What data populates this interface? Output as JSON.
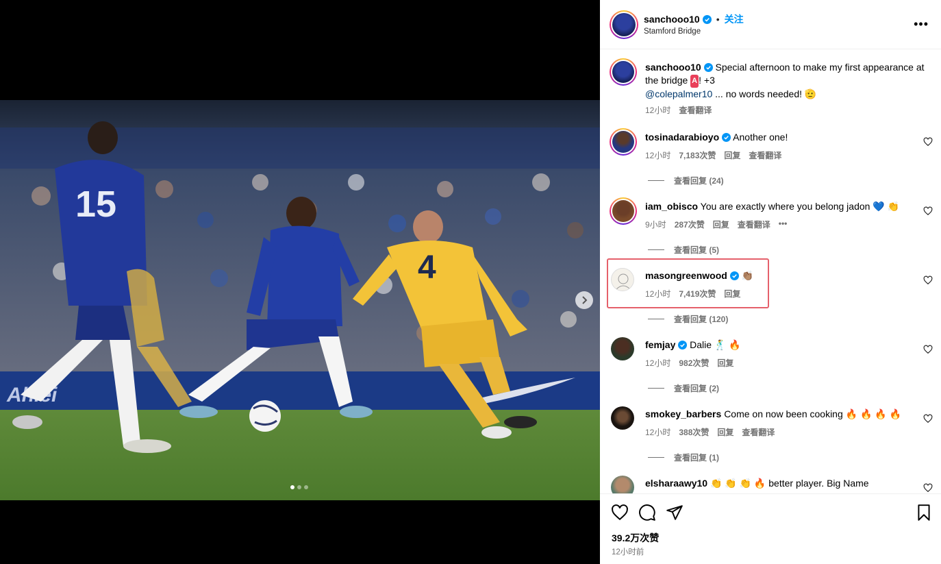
{
  "header": {
    "username": "sanchooo10",
    "follow_label": "关注",
    "location": "Stamford Bridge",
    "more_label": "•••"
  },
  "caption": {
    "username": "sanchooo10",
    "text_1": "Special afternoon to make my first appearance at the bridge",
    "badge": "A",
    "text_2": "! +3",
    "mention": "@colepalmer10",
    "text_3": "... no words needed! 🫡",
    "time": "12小时",
    "translate": "查看翻译"
  },
  "comments": [
    {
      "username": "tosinadarabioyo",
      "verified": true,
      "text": "Another one!",
      "time": "12小时",
      "likes": "7,183次赞",
      "reply": "回复",
      "translate": "查看翻译",
      "replies": "查看回复 (24)"
    },
    {
      "username": "iam_obisco",
      "verified": false,
      "text": "You are exactly where you belong jadon 💙 👏",
      "time": "9小时",
      "likes": "287次赞",
      "reply": "回复",
      "translate": "查看翻译",
      "more": "•••",
      "replies": "查看回复 (5)"
    },
    {
      "username": "masongreenwood",
      "verified": true,
      "text": "👏🏽",
      "time": "12小时",
      "likes": "7,419次赞",
      "reply": "回复",
      "replies": "查看回复 (120)"
    },
    {
      "username": "femjay",
      "verified": true,
      "text": "Dalie 🕺 🔥",
      "time": "12小时",
      "likes": "982次赞",
      "reply": "回复",
      "replies": "查看回复 (2)"
    },
    {
      "username": "smokey_barbers",
      "verified": false,
      "text": "Come on now been cooking 🔥 🔥 🔥 🔥",
      "time": "12小时",
      "likes": "388次赞",
      "reply": "回复",
      "translate": "查看翻译",
      "replies": "查看回复 (1)"
    },
    {
      "username": "elsharaawy10",
      "verified": false,
      "text": "👏 👏 👏 🔥  better player. Big Name"
    }
  ],
  "footer": {
    "likes": "39.2万次赞",
    "time": "12小时前"
  },
  "colors": {
    "accent": "#0095f6",
    "highlight": "#e5606b",
    "chelsea_blue": "#1f3c9e",
    "brighton_yellow": "#f3c338"
  },
  "photo": {
    "jersey_left": "15",
    "jersey_right": "4",
    "ad_text": "Ahlei"
  }
}
